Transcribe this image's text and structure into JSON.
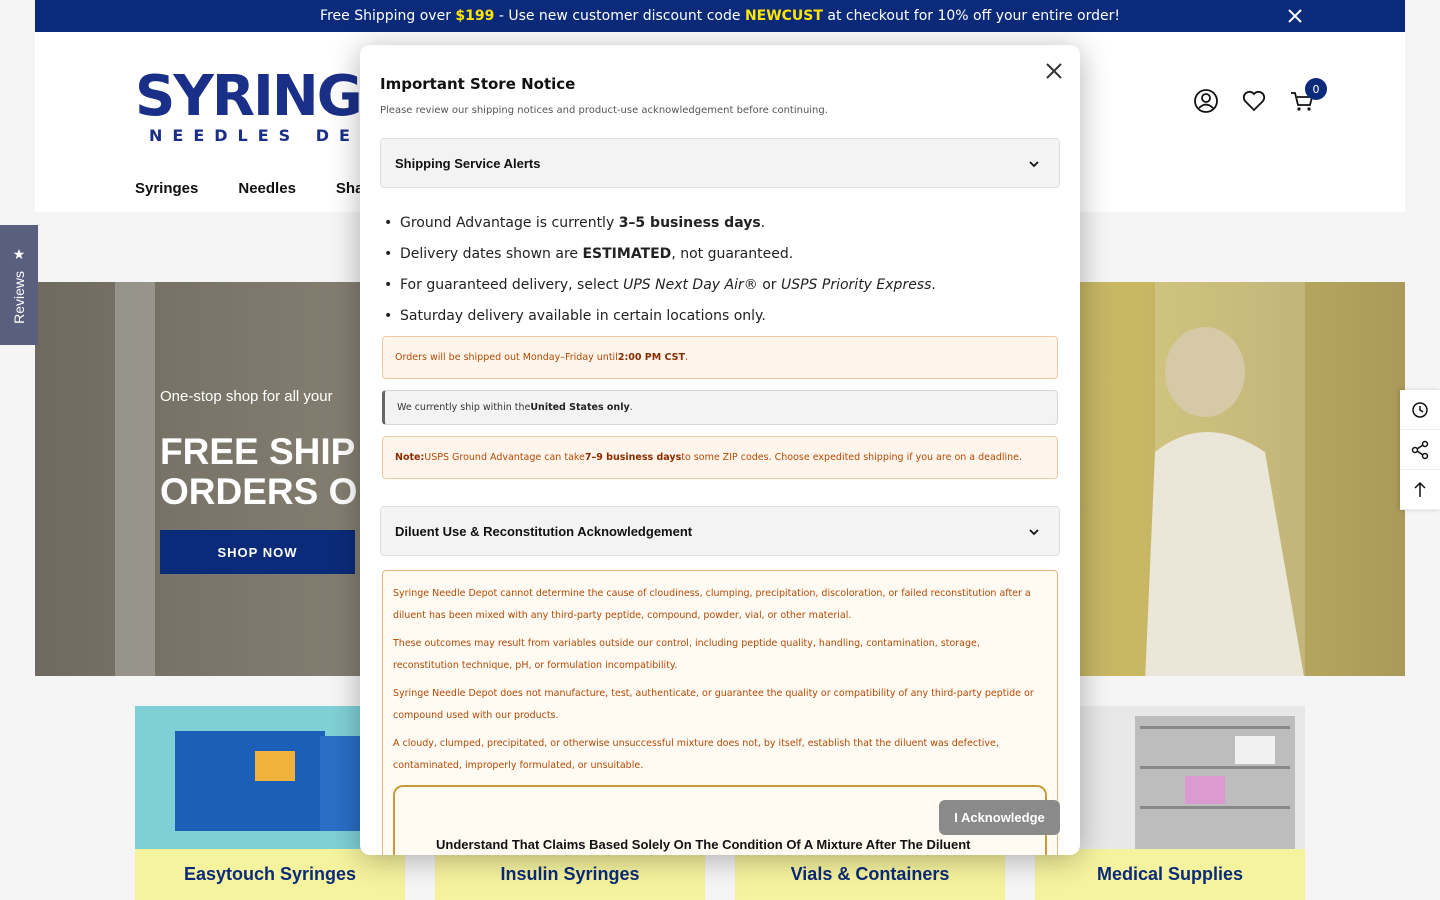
{
  "announcement": {
    "prefix": "Free Shipping over ",
    "amount": "$199",
    "middle": " - Use new customer discount code ",
    "code": "NEWCUST",
    "suffix": " at checkout for 10% off your entire order!"
  },
  "logo": {
    "word": "SYRINGE",
    "tagline": "NEEDLES DEPO"
  },
  "nav": [
    "Syringes",
    "Needles",
    "Sha"
  ],
  "cart": {
    "count": "0"
  },
  "hero": {
    "tagline": "One-stop shop for all your",
    "headline_line1": "FREE SHIP",
    "headline_line2": "ORDERS O",
    "cta": "SHOP NOW"
  },
  "categories": [
    {
      "label": "Easytouch Syringes"
    },
    {
      "label": "Insulin Syringes"
    },
    {
      "label": "Vials & Containers"
    },
    {
      "label": "Medical Supplies"
    }
  ],
  "reviews_tab": {
    "label": "Reviews"
  },
  "modal": {
    "title": "Important Store Notice",
    "subtitle": "Please review our shipping notices and product-use acknowledgement before continuing.",
    "section1_title": "Shipping Service Alerts",
    "bullets": [
      {
        "pre": "Ground Advantage is currently ",
        "bold": "3–5 business days",
        "post": "."
      },
      {
        "pre": "Delivery dates shown are ",
        "bold": "ESTIMATED",
        "post": ", not guaranteed."
      },
      {
        "pre": "For guaranteed delivery, select ",
        "it1": "UPS Next Day Air®",
        "mid": " or ",
        "it2": "USPS Priority Express",
        "post": "."
      },
      {
        "pre": "Saturday delivery available in certain locations only.",
        "bold": "",
        "post": ""
      }
    ],
    "box1": {
      "pre": "Orders will be shipped out Monday–Friday until ",
      "bold": "2:00 PM CST",
      "post": "."
    },
    "box2": {
      "pre": "We currently ship within the ",
      "bold": "United States only",
      "post": "."
    },
    "box3": {
      "label": "Note:",
      "pre": " USPS Ground Advantage can take ",
      "bold": "7–9 business days",
      "post": " to some ZIP codes. Choose expedited shipping if you are on a deadline."
    },
    "section2_title": "Diluent Use & Reconstitution Acknowledgement",
    "ack_paragraphs": [
      "Syringe Needle Depot cannot determine the cause of cloudiness, clumping, precipitation, discoloration, or failed reconstitution after a diluent has been mixed with any third-party peptide, compound, powder, vial, or other material.",
      "These outcomes may result from variables outside our control, including peptide quality, handling, contamination, storage, reconstitution technique, pH, or formulation incompatibility.",
      "Syringe Needle Depot does not manufacture, test, authenticate, or guarantee the quality or compatibility of any third-party peptide or compound used with our products.",
      "A cloudy, clumped, precipitated, or otherwise unsuccessful mixture does not, by itself, establish that the diluent was defective, contaminated, improperly formulated, or unsuitable."
    ],
    "ack_heading": "Understand That Claims Based Solely On The Condition Of A Mixture After The Diluent",
    "button": "I Acknowledge"
  }
}
